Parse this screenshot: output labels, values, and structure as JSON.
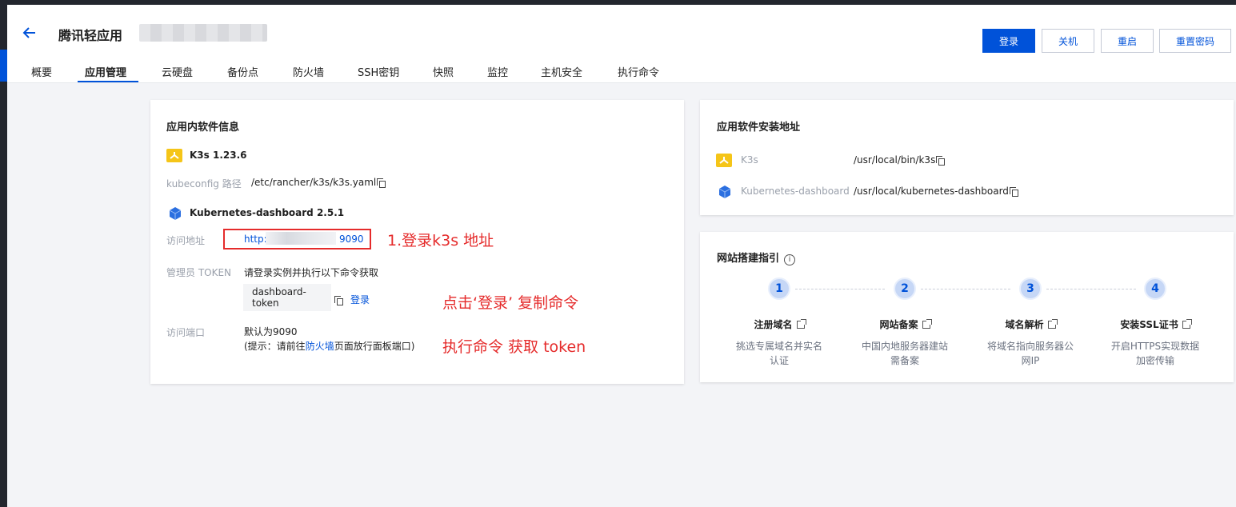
{
  "header": {
    "title": "腾讯轻应用",
    "buttons": {
      "login": "登录",
      "shutdown": "关机",
      "restart": "重启",
      "reset_password": "重置密码"
    }
  },
  "tabs": [
    {
      "label": "概要"
    },
    {
      "label": "应用管理",
      "active": true
    },
    {
      "label": "云硬盘"
    },
    {
      "label": "备份点"
    },
    {
      "label": "防火墙"
    },
    {
      "label": "SSH密钥"
    },
    {
      "label": "快照"
    },
    {
      "label": "监控"
    },
    {
      "label": "主机安全"
    },
    {
      "label": "执行命令"
    }
  ],
  "software_info": {
    "title": "应用内软件信息",
    "k3s": {
      "name": "K3s 1.23.6",
      "kubeconfig_label": "kubeconfig 路径",
      "kubeconfig_path": "/etc/rancher/k3s/k3s.yaml"
    },
    "dashboard": {
      "name": "Kubernetes-dashboard 2.5.1",
      "access_label": "访问地址",
      "access_url_prefix": "http:",
      "access_url_suffix": "9090",
      "token_label": "管理员 TOKEN",
      "token_hint": "请登录实例并执行以下命令获取",
      "token_command": "dashboard-token",
      "login_link": "登录",
      "port_label": "访问端口",
      "port_default": "默认为9090",
      "port_tip_prefix": "(提示：请前往",
      "port_tip_link": "防火墙",
      "port_tip_suffix": "页面放行面板端口)"
    }
  },
  "annotations": {
    "a1": "1.登录k3s 地址",
    "a2": "点击‘登录’  复制命令",
    "a3": "执行命令 获取 token"
  },
  "install_paths": {
    "title": "应用软件安装地址",
    "items": [
      {
        "name": "K3s",
        "path": "/usr/local/bin/k3s"
      },
      {
        "name": "Kubernetes-dashboard",
        "path": "/usr/local/kubernetes-dashboard"
      }
    ]
  },
  "guide": {
    "title": "网站搭建指引",
    "steps": [
      {
        "num": "1",
        "title": "注册域名",
        "desc": "挑选专属域名并实名认证"
      },
      {
        "num": "2",
        "title": "网站备案",
        "desc": "中国内地服务器建站需备案"
      },
      {
        "num": "3",
        "title": "域名解析",
        "desc": "将域名指向服务器公网IP"
      },
      {
        "num": "4",
        "title": "安装SSL证书",
        "desc": "开启HTTPS实现数据加密传输"
      }
    ]
  },
  "colors": {
    "accent": "#0052d9",
    "annotation_red": "#e52b2b",
    "k3s_yellow": "#f5c518"
  }
}
